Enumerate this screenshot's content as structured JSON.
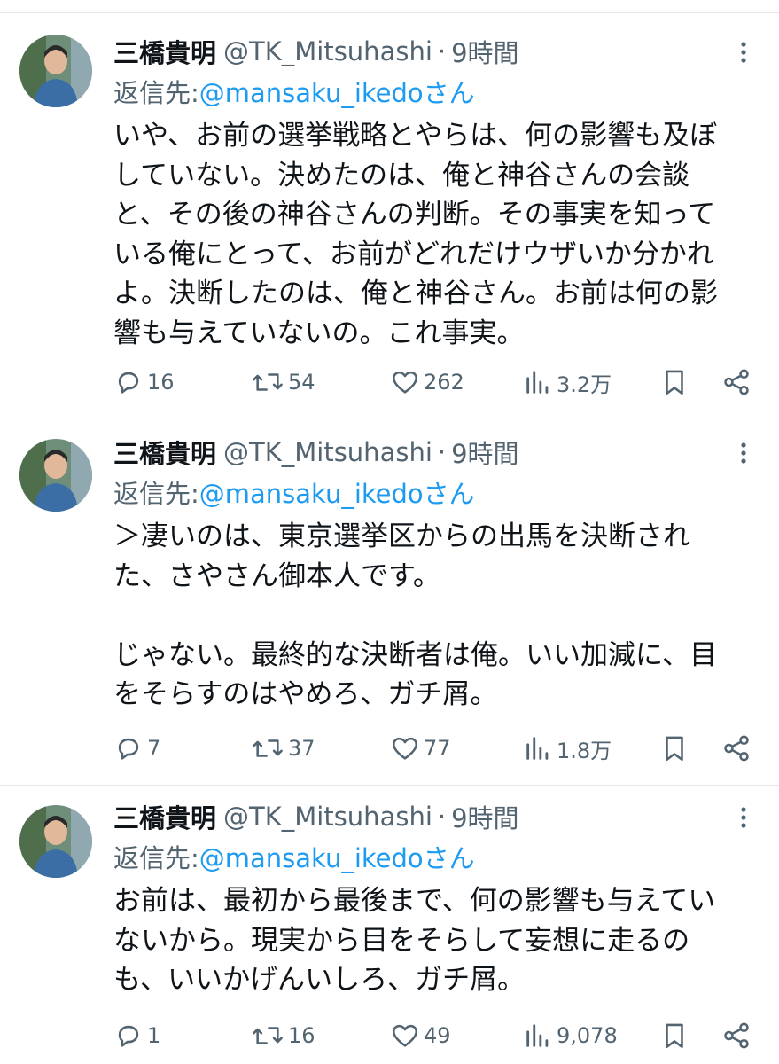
{
  "tweets": [
    {
      "name": "三橋貴明",
      "handle": "@TK_Mitsuhashi",
      "dot": "·",
      "time": "9時間",
      "reply_prefix": "返信先: ",
      "reply_mention": "@mansaku_ikedoさん",
      "lines": [
        "いや、お前の選挙戦略とやらは、何の影響も及ぼ",
        "していない。決めたのは、俺と神谷さんの会談",
        "と、その後の神谷さんの判断。その事実を知って",
        "いる俺にとって、お前がどれだけウザいか分かれ",
        "よ。決断したのは、俺と神谷さん。お前は何の影",
        "響も与えていないの。これ事実。"
      ],
      "replies": "16",
      "retweets": "54",
      "likes": "262",
      "views": "3.2万"
    },
    {
      "name": "三橋貴明",
      "handle": "@TK_Mitsuhashi",
      "dot": "·",
      "time": "9時間",
      "reply_prefix": "返信先: ",
      "reply_mention": "@mansaku_ikedoさん",
      "lines": [
        "＞凄いのは、東京選挙区からの出馬を決断され",
        "た、さやさん御本人です。",
        "",
        "じゃない。最終的な決断者は俺。いい加減に、目",
        "をそらすのはやめろ、ガチ屑。"
      ],
      "replies": "7",
      "retweets": "37",
      "likes": "77",
      "views": "1.8万"
    },
    {
      "name": "三橋貴明",
      "handle": "@TK_Mitsuhashi",
      "dot": "·",
      "time": "9時間",
      "reply_prefix": "返信先: ",
      "reply_mention": "@mansaku_ikedoさん",
      "lines": [
        "お前は、最初から最後まで、何の影響も与えてい",
        "ないから。現実から目をそらして妄想に走るの",
        "も、いいかげんいしろ、ガチ屑。"
      ],
      "replies": "1",
      "retweets": "16",
      "likes": "49",
      "views": "9,078"
    }
  ],
  "icons": {
    "reply": "reply-icon",
    "retweet": "retweet-icon",
    "like": "heart-icon",
    "views": "views-icon",
    "bookmark": "bookmark-icon",
    "share": "share-icon",
    "more": "more-vertical-icon"
  },
  "colors": {
    "text": "#0f1419",
    "secondary": "#536471",
    "link": "#1d9bf0",
    "divider": "#e6e9ec"
  }
}
